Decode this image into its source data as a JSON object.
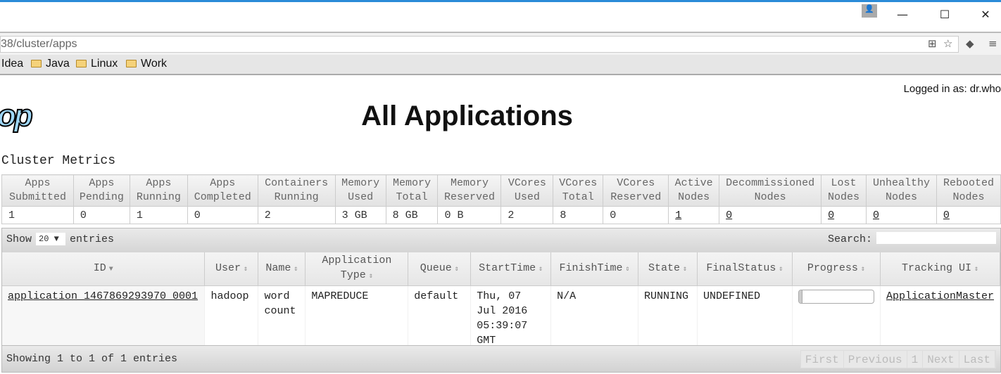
{
  "browser": {
    "url": "38/cluster/apps",
    "bookmarks": [
      "Idea",
      "Java",
      "Linux",
      "Work"
    ],
    "window_controls": {
      "minimize": "—",
      "maximize": "☐",
      "close": "✕"
    }
  },
  "header": {
    "logged_in": "Logged in as: dr.who",
    "title": "All Applications",
    "logo_text": "op"
  },
  "cluster_metrics": {
    "title": "Cluster Metrics",
    "columns": [
      [
        "Apps",
        "Submitted"
      ],
      [
        "Apps",
        "Pending"
      ],
      [
        "Apps",
        "Running"
      ],
      [
        "Apps",
        "Completed"
      ],
      [
        "Containers",
        "Running"
      ],
      [
        "Memory",
        "Used"
      ],
      [
        "Memory",
        "Total"
      ],
      [
        "Memory",
        "Reserved"
      ],
      [
        "VCores",
        "Used"
      ],
      [
        "VCores",
        "Total"
      ],
      [
        "VCores",
        "Reserved"
      ],
      [
        "Active",
        "Nodes"
      ],
      [
        "Decommissioned",
        "Nodes"
      ],
      [
        "Lost",
        "Nodes"
      ],
      [
        "Unhealthy",
        "Nodes"
      ],
      [
        "Rebooted",
        "Nodes"
      ]
    ],
    "values": [
      "1",
      "0",
      "1",
      "0",
      "2",
      "3 GB",
      "8 GB",
      "0 B",
      "2",
      "8",
      "0",
      "1",
      "0",
      "0",
      "0",
      "0"
    ],
    "links": [
      false,
      false,
      false,
      false,
      false,
      false,
      false,
      false,
      false,
      false,
      false,
      true,
      true,
      true,
      true,
      true
    ]
  },
  "apps_table": {
    "show_label": "Show",
    "entries_label": "entries",
    "page_size": "20",
    "search_label": "Search:",
    "search_value": "",
    "columns": [
      "ID",
      "User",
      "Name",
      "Application Type",
      "Queue",
      "StartTime",
      "FinishTime",
      "State",
      "FinalStatus",
      "Progress",
      "Tracking UI"
    ],
    "rows": [
      {
        "id": "application_1467869293970_0001",
        "user": "hadoop",
        "name": "word count",
        "type": "MAPREDUCE",
        "queue": "default",
        "start": "Thu, 07 Jul 2016 05:39:07 GMT",
        "finish": "N/A",
        "state": "RUNNING",
        "final_status": "UNDEFINED",
        "progress_percent": 5,
        "tracking": "ApplicationMaster"
      }
    ],
    "info": "Showing 1 to 1 of 1 entries",
    "pager": [
      "First",
      "Previous",
      "1",
      "Next",
      "Last"
    ]
  }
}
